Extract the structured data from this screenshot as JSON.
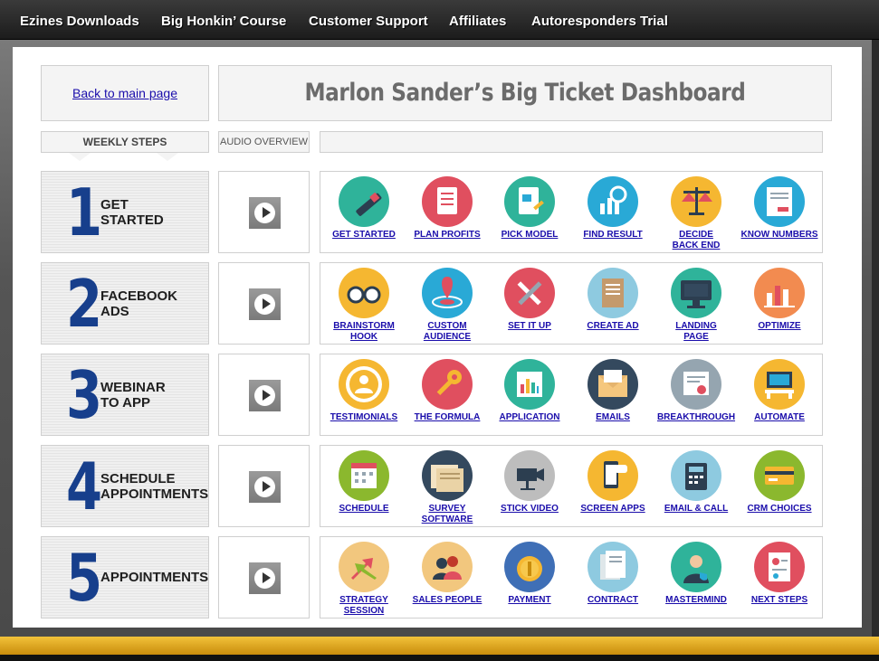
{
  "nav": {
    "items": [
      "Ezines Downloads",
      "Big Honkin’ Course",
      "Customer Support",
      "Affiliates",
      "Autoresponders Trial"
    ]
  },
  "header": {
    "back_link": "Back to main page",
    "title": "Marlon Sander’s Big Ticket Dashboard"
  },
  "tabs": {
    "weekly_steps": "WEEKLY STEPS",
    "audio_overview": "AUDIO OVERVIEW"
  },
  "colors": {
    "step_number": "#173f8c",
    "link": "#1a0dab",
    "gold_bar": "#e8b020"
  },
  "steps": [
    {
      "number": "1",
      "label": "GET\nSTARTED",
      "icons": [
        {
          "label": "GET STARTED",
          "icon": "pencil-icon",
          "color": "#2fb39a"
        },
        {
          "label": "PLAN PROFITS",
          "icon": "checklist-icon",
          "color": "#e04f5f"
        },
        {
          "label": "PICK MODEL",
          "icon": "document-edit-icon",
          "color": "#2fb39a"
        },
        {
          "label": "FIND RESULT",
          "icon": "magnifier-chart-icon",
          "color": "#29a9d6"
        },
        {
          "label": "DECIDE\nBACK END",
          "icon": "scales-icon",
          "color": "#f5b731"
        },
        {
          "label": "KNOW NUMBERS",
          "icon": "invoice-icon",
          "color": "#29a9d6"
        }
      ]
    },
    {
      "number": "2",
      "label": "FACEBOOK\nADS",
      "icons": [
        {
          "label": "BRAINSTORM\nHOOK",
          "icon": "glasses-icon",
          "color": "#f5b731"
        },
        {
          "label": "CUSTOM\nAUDIENCE",
          "icon": "target-pin-icon",
          "color": "#29a9d6"
        },
        {
          "label": "SET IT UP",
          "icon": "tools-icon",
          "color": "#e04f5f"
        },
        {
          "label": "CREATE AD",
          "icon": "scroll-icon",
          "color": "#8ecae0"
        },
        {
          "label": "LANDING\nPAGE",
          "icon": "monitor-icon",
          "color": "#2fb39a"
        },
        {
          "label": "OPTIMIZE",
          "icon": "bar-chart-icon",
          "color": "#f28b50"
        }
      ]
    },
    {
      "number": "3",
      "label": "WEBINAR\nTO APP",
      "icons": [
        {
          "label": "TESTIMONIALS",
          "icon": "user-badge-icon",
          "color": "#f5b731"
        },
        {
          "label": "THE FORMULA",
          "icon": "key-icon",
          "color": "#e04f5f"
        },
        {
          "label": "APPLICATION",
          "icon": "equalizer-icon",
          "color": "#2fb39a"
        },
        {
          "label": "EMAILS",
          "icon": "envelope-icon",
          "color": "#34495e"
        },
        {
          "label": "BREAKTHROUGH",
          "icon": "certificate-icon",
          "color": "#95a5b0"
        },
        {
          "label": "AUTOMATE",
          "icon": "workstation-icon",
          "color": "#f5b731"
        }
      ]
    },
    {
      "number": "4",
      "label": "SCHEDULE\nAPPOINTMENTS",
      "icons": [
        {
          "label": "SCHEDULE",
          "icon": "calendar-icon",
          "color": "#8bb82e"
        },
        {
          "label": "SURVEY\nSOFTWARE",
          "icon": "newspaper-icon",
          "color": "#34495e"
        },
        {
          "label": "STICK VIDEO",
          "icon": "video-camera-icon",
          "color": "#bdbdbd"
        },
        {
          "label": "SCREEN APPS",
          "icon": "smartphone-icon",
          "color": "#f5b731"
        },
        {
          "label": "EMAIL & CALL",
          "icon": "phone-icon",
          "color": "#8ecae0"
        },
        {
          "label": "CRM CHOICES",
          "icon": "credit-card-icon",
          "color": "#8bb82e"
        }
      ]
    },
    {
      "number": "5",
      "label": "APPOINTMENTS",
      "icons": [
        {
          "label": "STRATEGY\nSESSION",
          "icon": "arrows-icon",
          "color": "#f2c77e"
        },
        {
          "label": "SALES PEOPLE",
          "icon": "people-icon",
          "color": "#f2c77e"
        },
        {
          "label": "PAYMENT",
          "icon": "coin-icon",
          "color": "#3f6fb6"
        },
        {
          "label": "CONTRACT",
          "icon": "document-stack-icon",
          "color": "#8ecae0"
        },
        {
          "label": "MASTERMIND",
          "icon": "businessman-icon",
          "color": "#2fb39a"
        },
        {
          "label": "NEXT STEPS",
          "icon": "report-icon",
          "color": "#e04f5f"
        }
      ]
    }
  ]
}
